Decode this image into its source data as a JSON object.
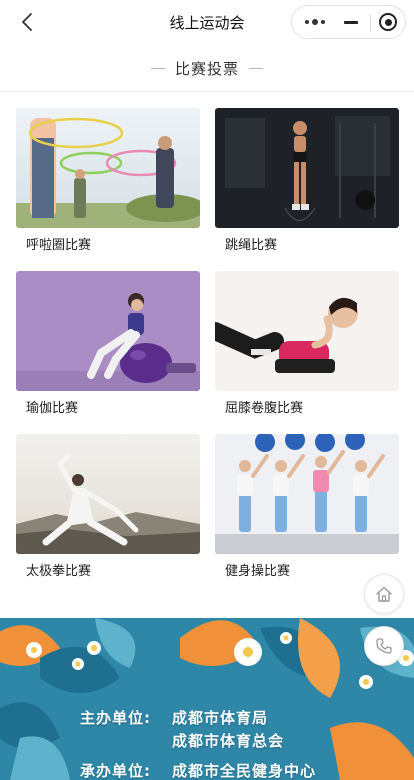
{
  "navbar": {
    "title": "线上运动会",
    "back_icon": "chevron-left-icon",
    "capsule": {
      "more_icon": "more-dots-icon",
      "minimize_icon": "minus-icon",
      "close_icon": "target-circle-icon"
    }
  },
  "section": {
    "title": "比赛投票"
  },
  "competitions": [
    {
      "label": "呼啦圈比赛",
      "image": "hula-hoop-photo"
    },
    {
      "label": "跳绳比赛",
      "image": "jump-rope-photo"
    },
    {
      "label": "瑜伽比赛",
      "image": "yoga-ball-photo"
    },
    {
      "label": "屈膝卷腹比赛",
      "image": "crunch-photo"
    },
    {
      "label": "太极拳比赛",
      "image": "tai-chi-photo"
    },
    {
      "label": "健身操比赛",
      "image": "aerobics-photo"
    }
  ],
  "banner": {
    "organizer_label": "主办单位:",
    "organizer_1": "成都市体育局",
    "organizer_2": "成都市体育总会",
    "host_label": "承办单位:",
    "host_1": "成都市全民健身中心"
  },
  "floating": {
    "home_icon": "home-icon",
    "phone_icon": "phone-icon"
  },
  "colors": {
    "banner_blue": "#2f87a8",
    "leaf_orange": "#f0913a",
    "text": "#222222"
  }
}
